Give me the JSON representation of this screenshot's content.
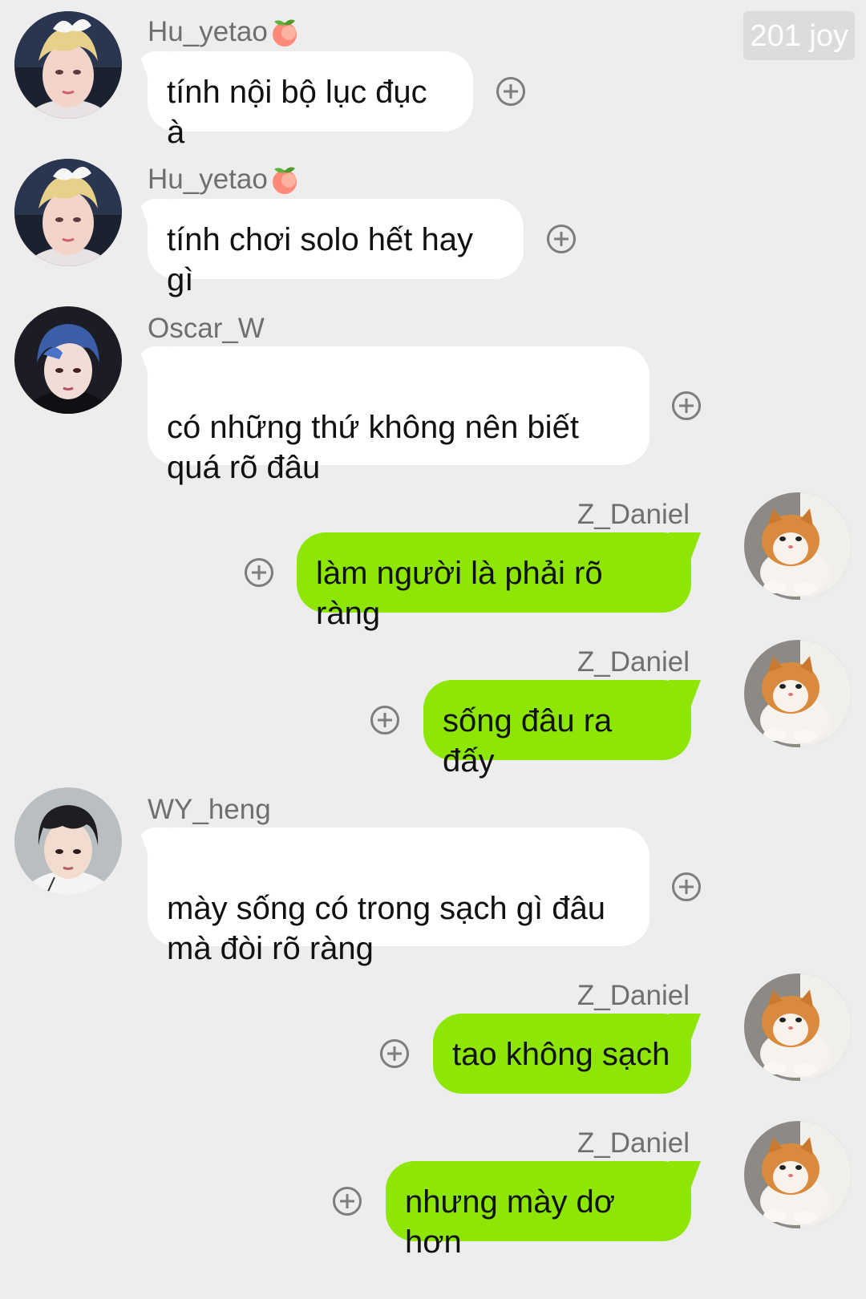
{
  "watermark": "201 joy",
  "messages": [
    {
      "side": "left",
      "sender": "Hu_yetao",
      "sender_emoji": "peach-icon",
      "text": "tính nội bộ lục đục à",
      "avatar": "avatar-blonde-boy"
    },
    {
      "side": "left",
      "sender": "Hu_yetao",
      "sender_emoji": "peach-icon",
      "text": "tính chơi solo hết hay gì",
      "avatar": "avatar-blonde-boy"
    },
    {
      "side": "left",
      "sender": "Oscar_W",
      "text": "có những thứ không nên biết\nquá rõ đâu",
      "avatar": "avatar-blue-hair"
    },
    {
      "side": "right",
      "sender": "Z_Daniel",
      "text": "làm người là phải rõ ràng",
      "avatar": "avatar-cat"
    },
    {
      "side": "right",
      "sender": "Z_Daniel",
      "text": "sống đâu ra đấy",
      "avatar": "avatar-cat"
    },
    {
      "side": "left",
      "sender": "WY_heng",
      "text": "mày sống có trong sạch gì đâu\nmà đòi rõ ràng",
      "avatar": "avatar-dark-hair"
    },
    {
      "side": "right",
      "sender": "Z_Daniel",
      "text": "tao không sạch",
      "avatar": "avatar-cat"
    },
    {
      "side": "right",
      "sender": "Z_Daniel",
      "text": "nhưng mày dơ hơn",
      "avatar": "avatar-cat"
    }
  ],
  "colors": {
    "background": "#ededed",
    "incoming_bubble": "#ffffff",
    "outgoing_bubble": "#8ee605",
    "sender_text": "#6f6f6f",
    "plus_icon": "#7d7d7d"
  }
}
